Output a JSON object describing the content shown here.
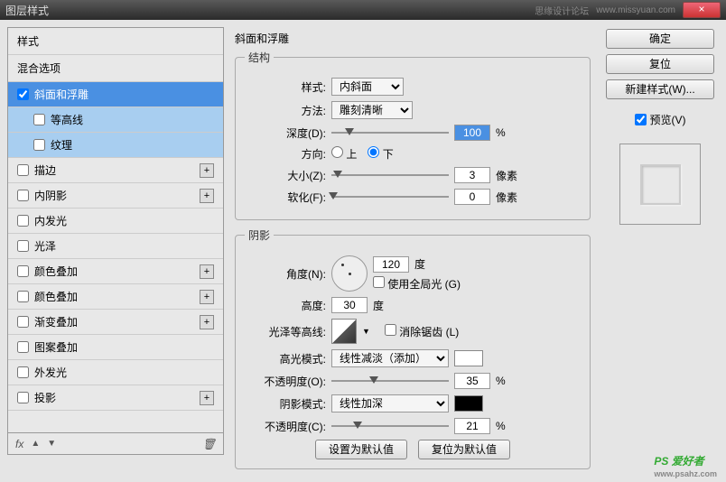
{
  "titlebar": {
    "title": "图层样式",
    "forum": "思缘设计论坛",
    "url": "www.missyuan.com",
    "close": "×"
  },
  "left": {
    "header1": "样式",
    "header2": "混合选项",
    "items": [
      {
        "label": "斜面和浮雕",
        "checked": true,
        "selected": true
      },
      {
        "label": "等高线",
        "sub": true
      },
      {
        "label": "纹理",
        "sub": true
      },
      {
        "label": "描边",
        "plus": true
      },
      {
        "label": "内阴影",
        "plus": true
      },
      {
        "label": "内发光"
      },
      {
        "label": "光泽"
      },
      {
        "label": "颜色叠加",
        "plus": true
      },
      {
        "label": "颜色叠加",
        "plus": true
      },
      {
        "label": "渐变叠加",
        "plus": true
      },
      {
        "label": "图案叠加"
      },
      {
        "label": "外发光"
      },
      {
        "label": "投影",
        "plus": true
      }
    ],
    "footer_fx": "fx"
  },
  "center": {
    "group_title": "斜面和浮雕",
    "struct_legend": "结构",
    "style_label": "样式:",
    "style_value": "内斜面",
    "method_label": "方法:",
    "method_value": "雕刻清晰",
    "depth_label": "深度(D):",
    "depth_value": "100",
    "depth_unit": "%",
    "direction_label": "方向:",
    "dir_up": "上",
    "dir_down": "下",
    "size_label": "大小(Z):",
    "size_value": "3",
    "size_unit": "像素",
    "soften_label": "软化(F):",
    "soften_value": "0",
    "soften_unit": "像素",
    "shadow_legend": "阴影",
    "angle_label": "角度(N):",
    "angle_value": "120",
    "angle_unit": "度",
    "global_light": "使用全局光 (G)",
    "altitude_label": "高度:",
    "altitude_value": "30",
    "altitude_unit": "度",
    "gloss_label": "光泽等高线:",
    "antialias": "消除锯齿 (L)",
    "highlight_mode_label": "高光模式:",
    "highlight_mode_value": "线性减淡（添加）",
    "highlight_opacity_label": "不透明度(O):",
    "highlight_opacity_value": "35",
    "highlight_opacity_unit": "%",
    "shadow_mode_label": "阴影模式:",
    "shadow_mode_value": "线性加深",
    "shadow_opacity_label": "不透明度(C):",
    "shadow_opacity_value": "21",
    "shadow_opacity_unit": "%",
    "set_default": "设置为默认值",
    "reset_default": "复位为默认值"
  },
  "right": {
    "ok": "确定",
    "cancel": "复位",
    "new_style": "新建样式(W)...",
    "preview": "预览(V)"
  },
  "logo": {
    "brand": "PS 爱好者",
    "url": "www.psahz.com"
  }
}
